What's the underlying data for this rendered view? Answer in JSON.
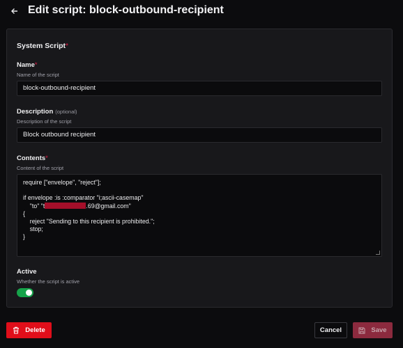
{
  "header": {
    "back_icon": "arrow-left-icon",
    "title": "Edit script: block-outbound-recipient"
  },
  "form": {
    "section_title": "System Script",
    "name": {
      "label": "Name",
      "help": "Name of the script",
      "value": "block-outbound-recipient"
    },
    "description": {
      "label": "Description",
      "optional": "(optional)",
      "help": "Description of the script",
      "value": "Block outbound recipient"
    },
    "contents": {
      "label": "Contents",
      "help": "Content of the script",
      "lines": [
        "require [\"envelope\", \"reject\"];",
        "",
        "if envelope :is :comparator \"i;ascii-casemap\"",
        "    \"to\" \"t",
        ".69@gmail.com\"",
        "{",
        "    reject \"Sending to this recipient is prohibited.\";",
        "    stop;",
        "}"
      ]
    },
    "active": {
      "label": "Active",
      "help": "Whether the script is active",
      "enabled": true
    }
  },
  "actions": {
    "delete_label": "Delete",
    "cancel_label": "Cancel",
    "save_label": "Save"
  },
  "colors": {
    "accent_red": "#e00e1a",
    "toggle_on": "#16a34a",
    "save_disabled": "#8c2a3e"
  }
}
